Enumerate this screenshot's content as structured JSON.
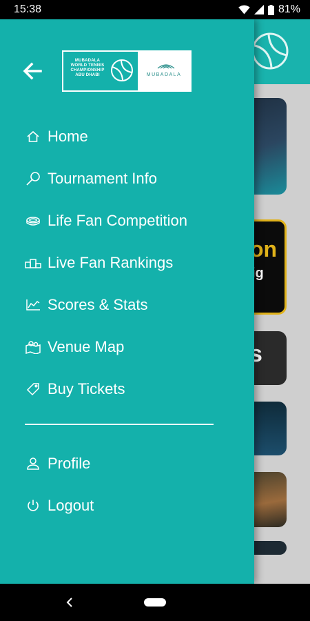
{
  "status_bar": {
    "time": "15:38",
    "battery": "81%",
    "icons": [
      "wifi-icon",
      "signal-icon",
      "battery-icon"
    ]
  },
  "drawer": {
    "logo": {
      "left_text": "MUBADALA WORLD TENNIS CHAMPIONSHIP ABU DHABI",
      "right_text": "MUBADALA"
    },
    "menu": [
      {
        "id": "home",
        "label": "Home",
        "icon": "home-icon"
      },
      {
        "id": "tournament-info",
        "label": "Tournament Info",
        "icon": "tennis-racket-icon"
      },
      {
        "id": "life-fan-competition",
        "label": "Life Fan Competition",
        "icon": "stadium-icon"
      },
      {
        "id": "live-fan-rankings",
        "label": "Live Fan Rankings",
        "icon": "podium-icon"
      },
      {
        "id": "scores-stats",
        "label": "Scores & Stats",
        "icon": "line-chart-icon"
      },
      {
        "id": "venue-map",
        "label": "Venue Map",
        "icon": "map-icon"
      },
      {
        "id": "buy-tickets",
        "label": "Buy Tickets",
        "icon": "ticket-icon"
      }
    ],
    "secondary_menu": [
      {
        "id": "profile",
        "label": "Profile",
        "icon": "person-icon"
      },
      {
        "id": "logout",
        "label": "Logout",
        "icon": "power-icon"
      }
    ]
  },
  "background": {
    "card_2_big": "on",
    "card_2_small": "ig",
    "card_3_big": "s"
  },
  "colors": {
    "drawer": "#14b1ab",
    "status_bar": "#000000",
    "card_accent": "#e0b21a"
  }
}
